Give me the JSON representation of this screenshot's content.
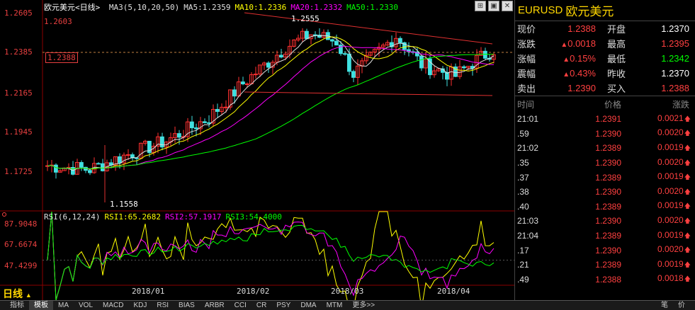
{
  "chart": {
    "title": "欧元美元<日线>",
    "ma_legend": [
      {
        "label": "MA3(5,10,20,50)",
        "color": "#e0e0e0"
      },
      {
        "label": "MA5:1.2359",
        "color": "#e0e0e0"
      },
      {
        "label": "MA10:1.2336",
        "color": "#ffff00"
      },
      {
        "label": "MA20:1.2332",
        "color": "#ff00ff"
      },
      {
        "label": "MA50:1.2330",
        "color": "#00ff00"
      }
    ],
    "rsi_legend": [
      {
        "label": "RSI(6,12,24)",
        "color": "#e0e0e0"
      },
      {
        "label": "RSI1:65.2682",
        "color": "#ffff00"
      },
      {
        "label": "RSI2:57.1917",
        "color": "#ff00ff"
      },
      {
        "label": "RSI3:54.4000",
        "color": "#00ff00"
      }
    ],
    "y_labels": [
      "1.2605",
      "1.2385",
      "1.2165",
      "1.1945",
      "1.1725"
    ],
    "rsi_labels": [
      "87.9048",
      "67.6674",
      "47.4299"
    ],
    "x_labels": [
      "2018/01",
      "2018/02",
      "2018/03",
      "2018/04"
    ],
    "high_label": "1.2603",
    "current_label": "1.2388",
    "peak_annotation": "1.2555",
    "low_annotation": "1.1558",
    "period": "日线"
  },
  "chart_data": {
    "type": "candlestick",
    "y_range": [
      1.155,
      1.261
    ],
    "indicators": [
      "MA5",
      "MA10",
      "MA20",
      "MA50",
      "RSI"
    ],
    "last_close": 1.2388,
    "period_high": 1.2555,
    "period_low": 1.1558
  },
  "quote": {
    "symbol": "EURUSD",
    "name": "欧元美元",
    "rows": [
      {
        "l1": "现价",
        "v1": "1.2388",
        "a1": false,
        "l2": "开盘",
        "v2": "1.2370",
        "c2": "#ffffff"
      },
      {
        "l1": "涨跌",
        "v1": "0.0018",
        "a1": true,
        "l2": "最高",
        "v2": "1.2395",
        "c2": "#ff4040"
      },
      {
        "l1": "涨幅",
        "v1": "0.15%",
        "a1": true,
        "l2": "最低",
        "v2": "1.2342",
        "c2": "#00ff00"
      },
      {
        "l1": "震幅",
        "v1": "0.43%",
        "a1": true,
        "l2": "昨收",
        "v2": "1.2370",
        "c2": "#ffffff"
      },
      {
        "l1": "卖出",
        "v1": "1.2390",
        "a1": false,
        "l2": "买入",
        "v2": "1.2388",
        "c2": "#ff4040"
      }
    ],
    "headers": [
      "时间",
      "价格",
      "涨跌"
    ],
    "ticks": [
      {
        "t": "21:01",
        "p": "1.2391",
        "c": "0.0021"
      },
      {
        "t": ".59",
        "p": "1.2390",
        "c": "0.0020"
      },
      {
        "t": "21:02",
        "p": "1.2389",
        "c": "0.0019"
      },
      {
        "t": ".35",
        "p": "1.2390",
        "c": "0.0020"
      },
      {
        "t": ".37",
        "p": "1.2389",
        "c": "0.0019"
      },
      {
        "t": ".38",
        "p": "1.2390",
        "c": "0.0020"
      },
      {
        "t": ".40",
        "p": "1.2389",
        "c": "0.0019"
      },
      {
        "t": "21:03",
        "p": "1.2390",
        "c": "0.0020"
      },
      {
        "t": "21:04",
        "p": "1.2389",
        "c": "0.0019"
      },
      {
        "t": ".17",
        "p": "1.2390",
        "c": "0.0020"
      },
      {
        "t": ".21",
        "p": "1.2389",
        "c": "0.0019"
      },
      {
        "t": ".49",
        "p": "1.2388",
        "c": "0.0018"
      }
    ]
  },
  "tabs": [
    "指标",
    "模板",
    "MA",
    "VOL",
    "MACD",
    "KDJ",
    "RSI",
    "BIAS",
    "ARBR",
    "CCI",
    "CR",
    "PSY",
    "DMA",
    "MTM",
    "更多>>"
  ],
  "right_tabs": [
    "笔",
    "价"
  ]
}
